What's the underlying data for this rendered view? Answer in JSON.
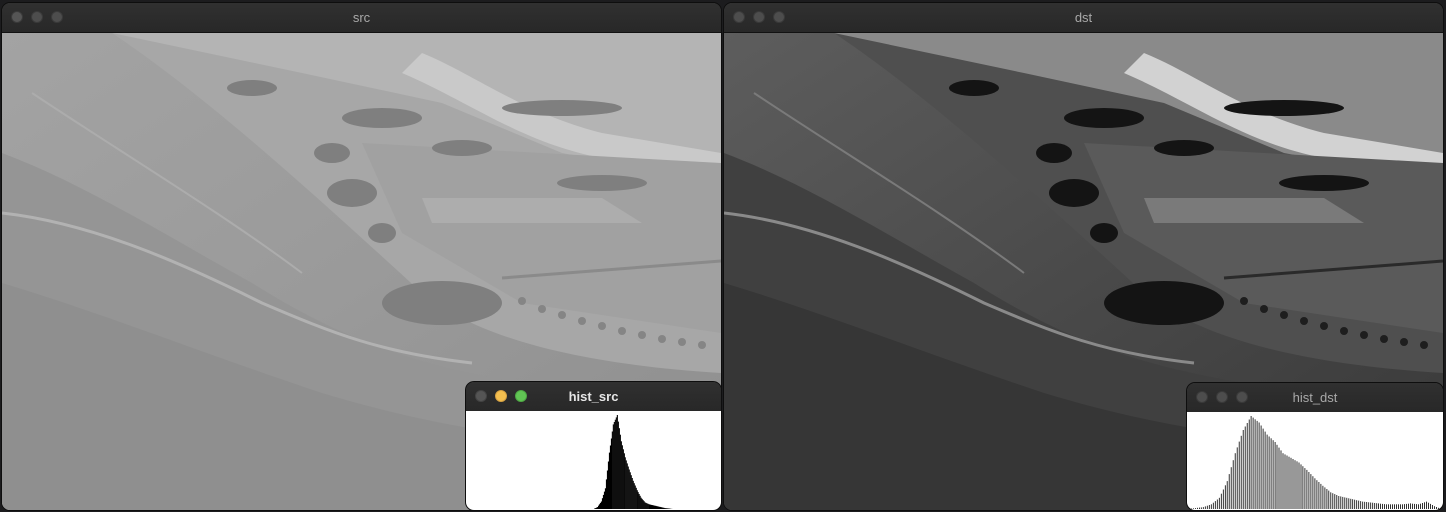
{
  "windows": {
    "src": {
      "title": "src"
    },
    "dst": {
      "title": "dst"
    },
    "hist_src": {
      "title": "hist_src"
    },
    "hist_dst": {
      "title": "hist_dst"
    }
  },
  "images": {
    "src": {
      "description_icon": "landscape-photo-low-contrast",
      "tone": "flat-gray"
    },
    "dst": {
      "description_icon": "landscape-photo-equalized",
      "tone": "high-contrast"
    }
  },
  "chart_data": [
    {
      "type": "bar",
      "x": [
        0,
        8,
        16,
        24,
        32,
        40,
        48,
        56,
        64,
        72,
        80,
        88,
        96,
        104,
        112,
        120,
        128,
        132,
        136,
        140,
        144,
        148,
        152,
        156,
        160,
        164,
        168,
        172,
        176,
        180,
        184,
        188,
        192,
        196,
        200,
        208,
        216,
        224,
        232,
        240,
        248,
        255
      ],
      "values": [
        0,
        0,
        0,
        0,
        0,
        0,
        0,
        0,
        0,
        0,
        0,
        0,
        0,
        0,
        0,
        0,
        0,
        0.02,
        0.08,
        0.22,
        0.6,
        0.9,
        1.0,
        0.72,
        0.55,
        0.42,
        0.3,
        0.2,
        0.12,
        0.07,
        0.05,
        0.04,
        0.03,
        0.02,
        0.01,
        0,
        0,
        0,
        0,
        0,
        0,
        0
      ],
      "ylim": [
        0,
        1
      ],
      "xlim": [
        0,
        255
      ]
    },
    {
      "type": "bar",
      "x": [
        0,
        8,
        16,
        24,
        32,
        40,
        48,
        56,
        64,
        72,
        80,
        88,
        96,
        104,
        112,
        120,
        128,
        136,
        144,
        152,
        160,
        168,
        176,
        184,
        192,
        200,
        208,
        216,
        224,
        232,
        240,
        248,
        255
      ],
      "values": [
        0,
        0.01,
        0.02,
        0.05,
        0.12,
        0.3,
        0.6,
        0.85,
        1.0,
        0.93,
        0.8,
        0.72,
        0.6,
        0.55,
        0.5,
        0.42,
        0.33,
        0.25,
        0.18,
        0.14,
        0.12,
        0.1,
        0.08,
        0.07,
        0.06,
        0.05,
        0.05,
        0.05,
        0.06,
        0.05,
        0.08,
        0.03,
        0
      ],
      "ylim": [
        0,
        1
      ],
      "xlim": [
        0,
        255
      ]
    }
  ]
}
